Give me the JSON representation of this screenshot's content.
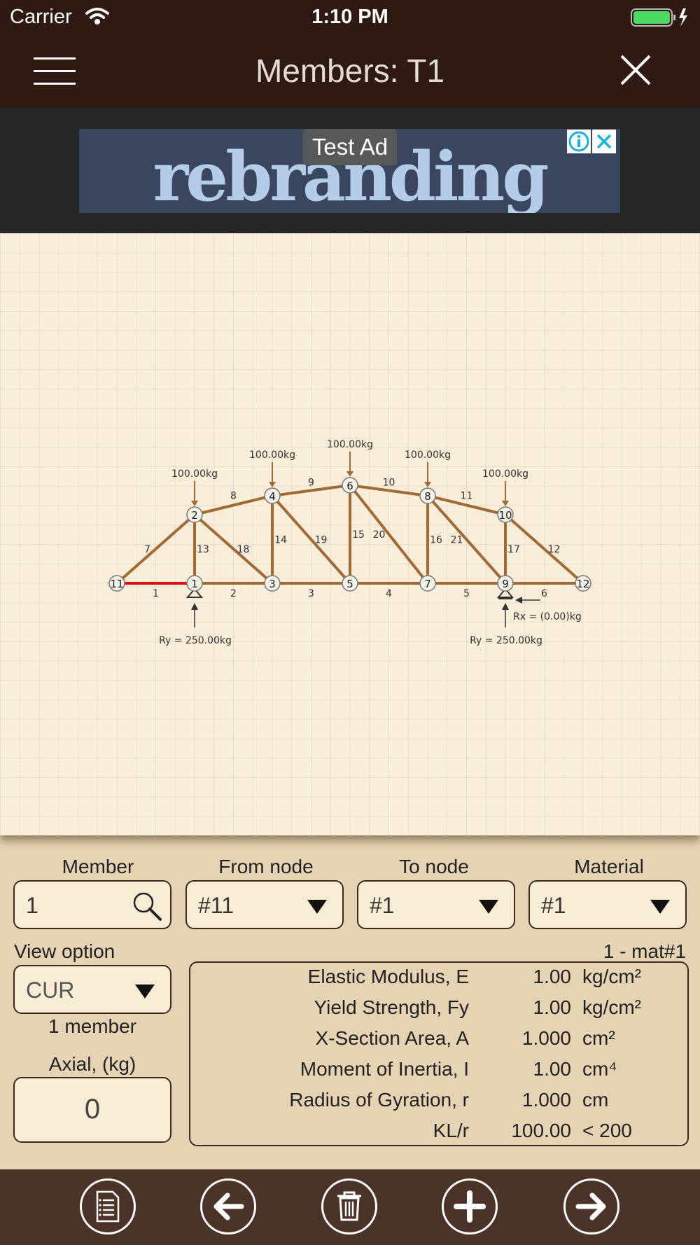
{
  "status": {
    "carrier": "Carrier",
    "time": "1:10 PM"
  },
  "nav": {
    "title": "Members: T1"
  },
  "ad": {
    "label": "Test Ad",
    "brand_text": "rebranding"
  },
  "diagram": {
    "loads": [
      "100.00kg",
      "100.00kg",
      "100.00kg",
      "100.00kg",
      "100.00kg"
    ],
    "reactions": {
      "left_ry": "Ry = 250.00kg",
      "right_ry": "Ry = 250.00kg",
      "right_rx": "Rx = (0.00)kg"
    },
    "nodes": [
      "1",
      "2",
      "3",
      "4",
      "5",
      "6",
      "7",
      "8",
      "9",
      "10",
      "11",
      "12"
    ],
    "members": [
      "1",
      "2",
      "3",
      "4",
      "5",
      "6",
      "7",
      "8",
      "9",
      "10",
      "11",
      "12",
      "13",
      "14",
      "15",
      "16",
      "17",
      "18",
      "19",
      "20",
      "21"
    ],
    "selected_member": "1",
    "colors": {
      "member": "#a06a35",
      "selected": "#e01010",
      "background": "#faeedb"
    }
  },
  "form": {
    "member_label": "Member",
    "member_value": "1",
    "from_label": "From node",
    "from_value": "#11",
    "to_label": "To node",
    "to_value": "#1",
    "material_label": "Material",
    "material_value": "#1",
    "view_option_label": "View option",
    "view_option_value": "CUR",
    "member_count": "1 member",
    "axial_label": "Axial, (kg)",
    "axial_value": "0",
    "material_name": "1 - mat#1"
  },
  "properties": [
    {
      "label": "Elastic Modulus, E",
      "value": "1.00",
      "unit": "kg/cm²"
    },
    {
      "label": "Yield Strength, Fy",
      "value": "1.00",
      "unit": "kg/cm²"
    },
    {
      "label": "X-Section Area, A",
      "value": "1.000",
      "unit": "cm²"
    },
    {
      "label": "Moment of Inertia, I",
      "value": "1.00",
      "unit": "cm⁴"
    },
    {
      "label": "Radius of Gyration, r",
      "value": "1.000",
      "unit": "cm"
    },
    {
      "label": "KL/r",
      "value": "100.00",
      "unit": "< 200"
    }
  ],
  "toolbar": [
    "list-icon",
    "arrow-left-icon",
    "trash-icon",
    "plus-icon",
    "arrow-right-icon"
  ]
}
